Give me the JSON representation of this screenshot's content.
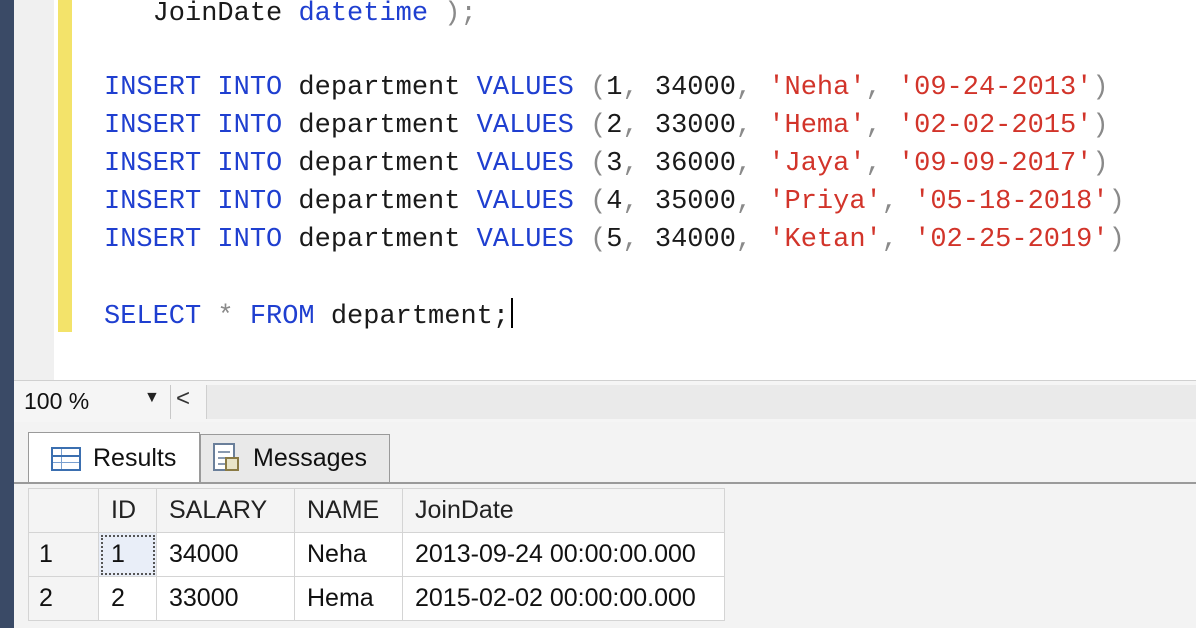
{
  "editor": {
    "lines": [
      [
        {
          "t": "   JoinDate ",
          "c": "plain"
        },
        {
          "t": "datetime",
          "c": "kw"
        },
        {
          "t": " );",
          "c": "punc"
        }
      ],
      [],
      [
        {
          "t": "INSERT INTO",
          "c": "kw"
        },
        {
          "t": " department ",
          "c": "plain"
        },
        {
          "t": "VALUES",
          "c": "kw"
        },
        {
          "t": " (",
          "c": "punc"
        },
        {
          "t": "1",
          "c": "plain"
        },
        {
          "t": ", ",
          "c": "punc"
        },
        {
          "t": "34000",
          "c": "plain"
        },
        {
          "t": ", ",
          "c": "punc"
        },
        {
          "t": "'Neha'",
          "c": "str"
        },
        {
          "t": ", ",
          "c": "punc"
        },
        {
          "t": "'09-24-2013'",
          "c": "str"
        },
        {
          "t": ")",
          "c": "punc"
        }
      ],
      [
        {
          "t": "INSERT INTO",
          "c": "kw"
        },
        {
          "t": " department ",
          "c": "plain"
        },
        {
          "t": "VALUES",
          "c": "kw"
        },
        {
          "t": " (",
          "c": "punc"
        },
        {
          "t": "2",
          "c": "plain"
        },
        {
          "t": ", ",
          "c": "punc"
        },
        {
          "t": "33000",
          "c": "plain"
        },
        {
          "t": ", ",
          "c": "punc"
        },
        {
          "t": "'Hema'",
          "c": "str"
        },
        {
          "t": ", ",
          "c": "punc"
        },
        {
          "t": "'02-02-2015'",
          "c": "str"
        },
        {
          "t": ")",
          "c": "punc"
        }
      ],
      [
        {
          "t": "INSERT INTO",
          "c": "kw"
        },
        {
          "t": " department ",
          "c": "plain"
        },
        {
          "t": "VALUES",
          "c": "kw"
        },
        {
          "t": " (",
          "c": "punc"
        },
        {
          "t": "3",
          "c": "plain"
        },
        {
          "t": ", ",
          "c": "punc"
        },
        {
          "t": "36000",
          "c": "plain"
        },
        {
          "t": ", ",
          "c": "punc"
        },
        {
          "t": "'Jaya'",
          "c": "str"
        },
        {
          "t": ", ",
          "c": "punc"
        },
        {
          "t": "'09-09-2017'",
          "c": "str"
        },
        {
          "t": ")",
          "c": "punc"
        }
      ],
      [
        {
          "t": "INSERT INTO",
          "c": "kw"
        },
        {
          "t": " department ",
          "c": "plain"
        },
        {
          "t": "VALUES",
          "c": "kw"
        },
        {
          "t": " (",
          "c": "punc"
        },
        {
          "t": "4",
          "c": "plain"
        },
        {
          "t": ", ",
          "c": "punc"
        },
        {
          "t": "35000",
          "c": "plain"
        },
        {
          "t": ", ",
          "c": "punc"
        },
        {
          "t": "'Priya'",
          "c": "str"
        },
        {
          "t": ", ",
          "c": "punc"
        },
        {
          "t": "'05-18-2018'",
          "c": "str"
        },
        {
          "t": ")",
          "c": "punc"
        }
      ],
      [
        {
          "t": "INSERT INTO",
          "c": "kw"
        },
        {
          "t": " department ",
          "c": "plain"
        },
        {
          "t": "VALUES",
          "c": "kw"
        },
        {
          "t": " (",
          "c": "punc"
        },
        {
          "t": "5",
          "c": "plain"
        },
        {
          "t": ", ",
          "c": "punc"
        },
        {
          "t": "34000",
          "c": "plain"
        },
        {
          "t": ", ",
          "c": "punc"
        },
        {
          "t": "'Ketan'",
          "c": "str"
        },
        {
          "t": ", ",
          "c": "punc"
        },
        {
          "t": "'02-25-2019'",
          "c": "str"
        },
        {
          "t": ")",
          "c": "punc"
        }
      ],
      [],
      [
        {
          "t": "SELECT",
          "c": "kw"
        },
        {
          "t": " * ",
          "c": "punc"
        },
        {
          "t": "FROM",
          "c": "kw"
        },
        {
          "t": " department;",
          "c": "plain"
        }
      ]
    ]
  },
  "colors": {
    "keyword": "#1f3fd0",
    "string": "#d2342a",
    "punctuation": "#8a8a8a",
    "change_bar": "#f3e36a"
  },
  "zoom": {
    "value": "100 %",
    "dropdown_icon": "caret-down-icon",
    "scroll_left": "<"
  },
  "tabs": [
    {
      "label": "Results",
      "icon": "grid-icon",
      "active": true
    },
    {
      "label": "Messages",
      "icon": "messages-icon",
      "active": false
    }
  ],
  "results": {
    "columns": [
      "ID",
      "SALARY",
      "NAME",
      "JoinDate"
    ],
    "rows": [
      {
        "rownum": "1",
        "cells": [
          "1",
          "34000",
          "Neha",
          "2013-09-24 00:00:00.000"
        ]
      },
      {
        "rownum": "2",
        "cells": [
          "2",
          "33000",
          "Hema",
          "2015-02-02 00:00:00.000"
        ]
      }
    ]
  }
}
